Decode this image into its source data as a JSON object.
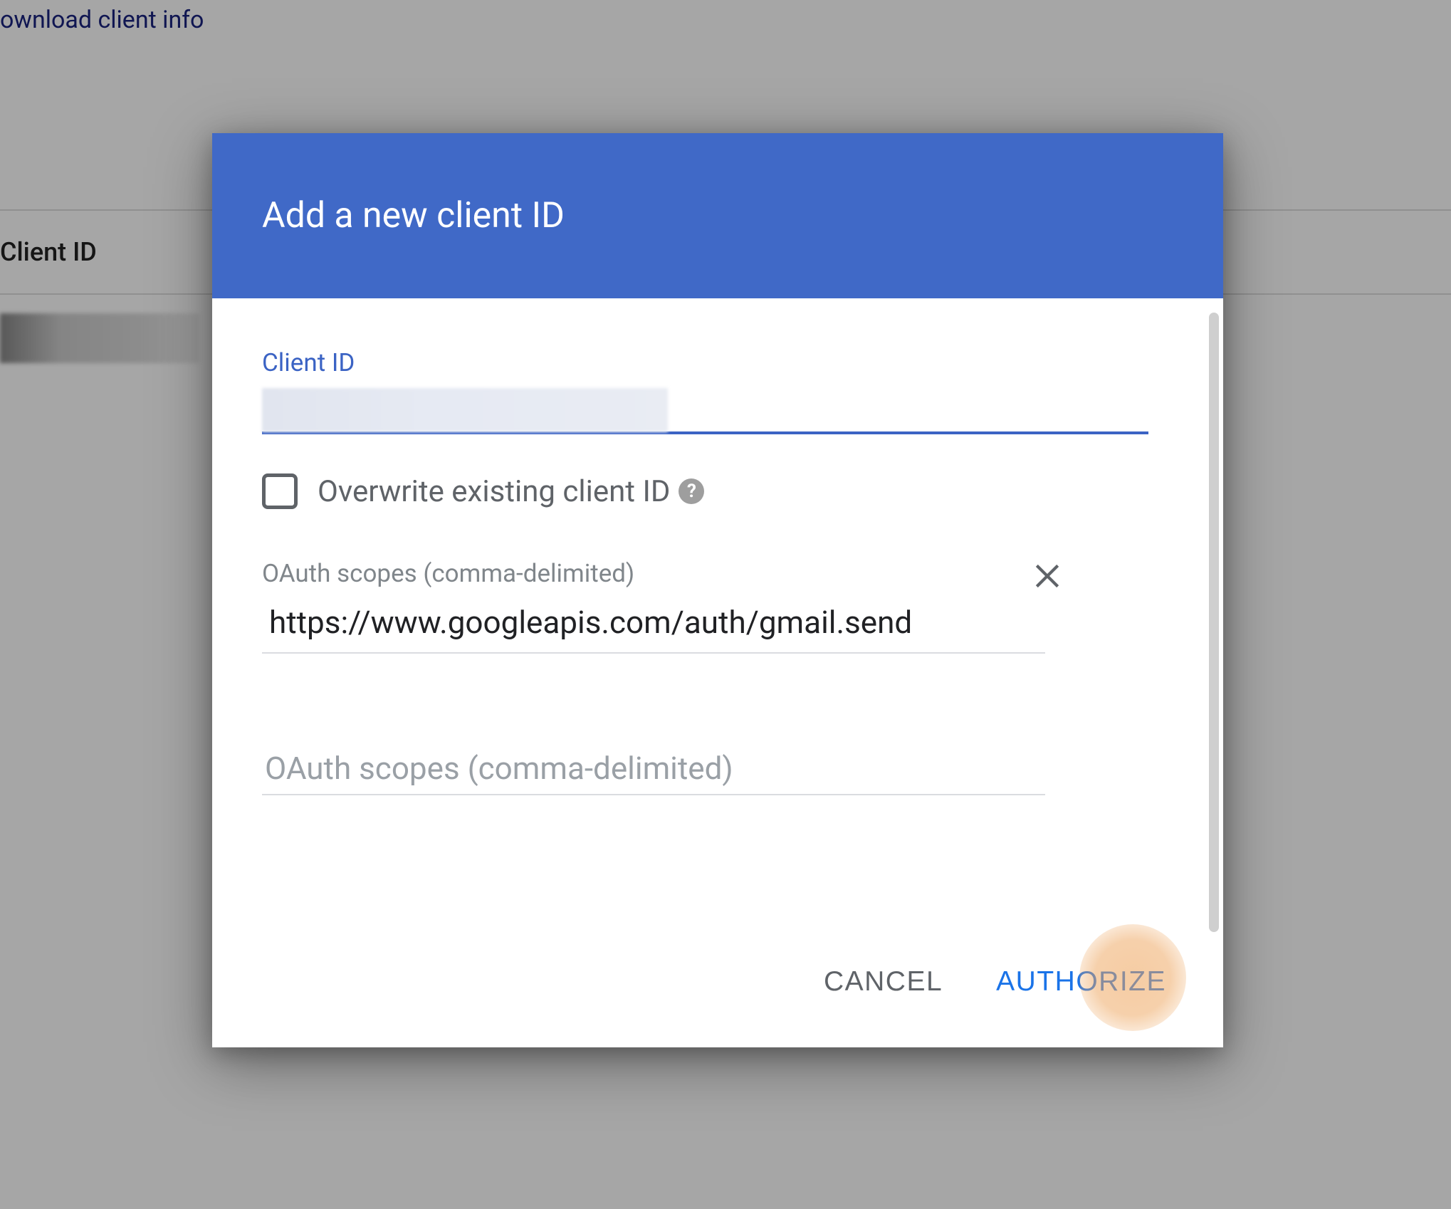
{
  "background": {
    "download_link": "ownload client info",
    "column_header": "Client ID"
  },
  "dialog": {
    "title": "Add a new client ID",
    "client_id": {
      "label": "Client ID"
    },
    "overwrite": {
      "label": "Overwrite existing client ID"
    },
    "scopes_filled": {
      "label": "OAuth scopes (comma-delimited)",
      "value": "https://www.googleapis.com/auth/gmail.send"
    },
    "scopes_empty": {
      "placeholder": "OAuth scopes (comma-delimited)"
    },
    "buttons": {
      "cancel": "CANCEL",
      "authorize": "AUTHORIZE"
    }
  }
}
